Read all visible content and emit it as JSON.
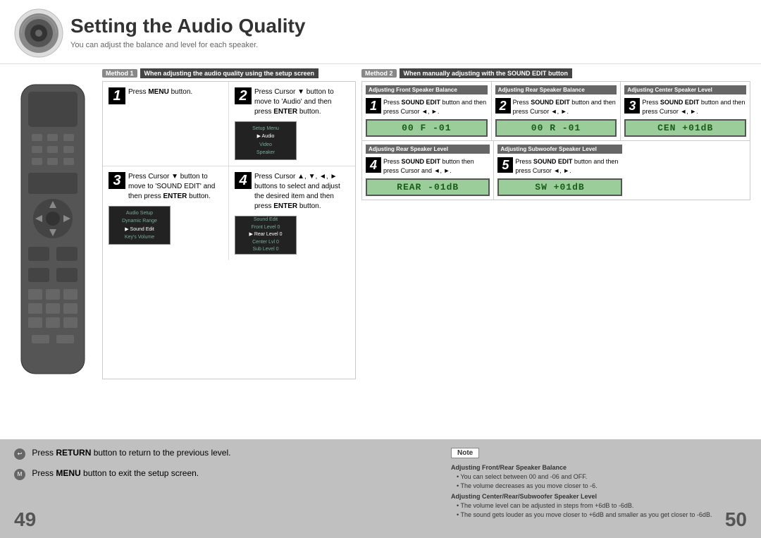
{
  "page": {
    "title": "Setting the Audio Quality",
    "subtitle": "You can adjust the balance and level for each speaker.",
    "page_num_left": "49",
    "page_num_right": "50"
  },
  "method1": {
    "label": "Method 1",
    "heading": "When adjusting the audio quality using the setup screen",
    "steps": [
      {
        "num": "1",
        "text": "Press MENU button."
      },
      {
        "num": "2",
        "text": "Press Cursor ▼ button to move to 'Audio' and then press ENTER button."
      },
      {
        "num": "3",
        "text": "Press Cursor ▼ button to move to 'SOUND EDIT' and then press ENTER button."
      },
      {
        "num": "4",
        "text": "Press Cursor ▲, ▼, ◄, ► buttons to select and adjust the desired item and then press ENTER button."
      }
    ]
  },
  "method2": {
    "label": "Method 2",
    "heading": "When manually adjusting with the SOUND EDIT button",
    "sections": [
      {
        "id": "front-balance",
        "title": "Adjusting Front Speaker Balance",
        "step_num": "1",
        "text": "Press SOUND EDIT button and then press Cursor ◄, ►.",
        "lcd": "00 F  -01"
      },
      {
        "id": "rear-balance",
        "title": "Adjusting Rear Speaker Balance",
        "step_num": "2",
        "text": "Press SOUND EDIT button and then press Cursor ◄, ►.",
        "lcd": "00 R  -01"
      },
      {
        "id": "center-level",
        "title": "Adjusting Center Speaker Level",
        "step_num": "3",
        "text": "Press SOUND EDIT button and then press Cursor ◄, ►.",
        "lcd": "CEN  +01dB"
      },
      {
        "id": "rear-level",
        "title": "Adjusting Rear Speaker Level",
        "step_num": "4",
        "text": "Press SOUND EDIT button then press Cursor and ◄, ►.",
        "lcd": "REAR  -01dB"
      },
      {
        "id": "subwoofer-level",
        "title": "Adjusting Subwoofer Speaker Level",
        "step_num": "5",
        "text": "Press SOUND EDIT button and then press Cursor ◄, ►.",
        "lcd": "SW   +01dB"
      }
    ]
  },
  "bottom": {
    "return_text": "Press RETURN button to return to the previous level.",
    "menu_text": "Press MENU button to exit the setup screen.",
    "note_label": "Note",
    "note1_title": "Adjusting Front/Rear Speaker Balance",
    "note1_items": [
      "You can select between 00 and -06 and OFF.",
      "The volume decreases as you move closer to -6."
    ],
    "note2_title": "Adjusting Center/Rear/Subwoofer Speaker Level",
    "note2_items": [
      "The volume level can be adjusted in steps from +6dB to -6dB.",
      "The sound gets louder as you move closer to +6dB and smaller as you get closer to -6dB."
    ]
  }
}
